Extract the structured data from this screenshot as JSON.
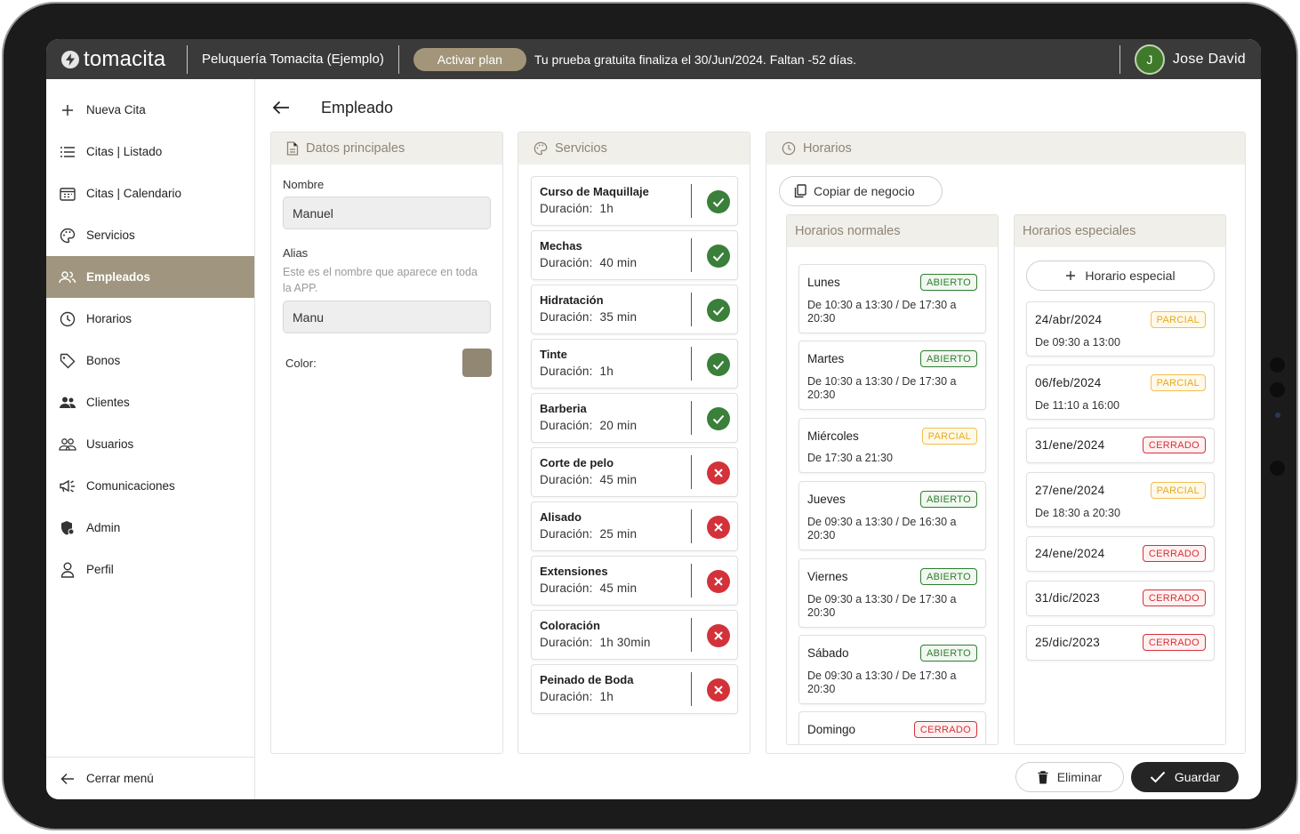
{
  "topbar": {
    "logo_text": "tomacita",
    "business_name": "Peluquería Tomacita (Ejemplo)",
    "activate_label": "Activar plan",
    "trial_text": "Tu prueba gratuita finaliza el 30/Jun/2024. Faltan -52 días.",
    "user_initial": "J",
    "user_name": "Jose David"
  },
  "sidebar": {
    "items": [
      {
        "label": "Nueva Cita",
        "icon": "plus-icon"
      },
      {
        "label": "Citas | Listado",
        "icon": "list-icon"
      },
      {
        "label": "Citas | Calendario",
        "icon": "calendar-icon"
      },
      {
        "label": "Servicios",
        "icon": "palette-icon"
      },
      {
        "label": "Empleados",
        "icon": "people-icon",
        "active": true
      },
      {
        "label": "Horarios",
        "icon": "clock-icon"
      },
      {
        "label": "Bonos",
        "icon": "tag-icon"
      },
      {
        "label": "Clientes",
        "icon": "clients-icon"
      },
      {
        "label": "Usuarios",
        "icon": "users-icon"
      },
      {
        "label": "Comunicaciones",
        "icon": "megaphone-icon"
      },
      {
        "label": "Admin",
        "icon": "admin-shield-icon"
      },
      {
        "label": "Perfil",
        "icon": "person-icon"
      }
    ],
    "close_label": "Cerrar menú"
  },
  "page": {
    "title": "Empleado"
  },
  "datos": {
    "title": "Datos principales",
    "nombre_label": "Nombre",
    "nombre_value": "Manuel",
    "alias_label": "Alias",
    "alias_help": "Este es el nombre que aparece en toda la APP.",
    "alias_value": "Manu",
    "color_label": "Color:",
    "color_value": "#918773"
  },
  "servicios": {
    "title": "Servicios",
    "duration_prefix": "Duración:",
    "items": [
      {
        "name": "Curso de Maquillaje",
        "duration": "1h",
        "enabled": true
      },
      {
        "name": "Mechas",
        "duration": "40 min",
        "enabled": true
      },
      {
        "name": "Hidratación",
        "duration": "35 min",
        "enabled": true
      },
      {
        "name": "Tinte",
        "duration": "1h",
        "enabled": true
      },
      {
        "name": "Barberia",
        "duration": "20 min",
        "enabled": true
      },
      {
        "name": "Corte de pelo",
        "duration": "45 min",
        "enabled": false
      },
      {
        "name": "Alisado",
        "duration": "25 min",
        "enabled": false
      },
      {
        "name": "Extensiones",
        "duration": "45 min",
        "enabled": false
      },
      {
        "name": "Coloración",
        "duration": "1h 30min",
        "enabled": false
      },
      {
        "name": "Peinado de Boda",
        "duration": "1h",
        "enabled": false
      }
    ]
  },
  "horarios": {
    "title": "Horarios",
    "copy_label": "Copiar de negocio",
    "normales_title": "Horarios normales",
    "especiales_title": "Horarios especiales",
    "add_special_label": "Horario especial",
    "days": [
      {
        "day": "Lunes",
        "status": "ABIERTO",
        "times": "De 10:30 a 13:30 / De 17:30 a 20:30"
      },
      {
        "day": "Martes",
        "status": "ABIERTO",
        "times": "De 10:30 a 13:30 / De 17:30 a 20:30"
      },
      {
        "day": "Miércoles",
        "status": "PARCIAL",
        "times": "De 17:30 a 21:30"
      },
      {
        "day": "Jueves",
        "status": "ABIERTO",
        "times": "De 09:30 a 13:30 / De 16:30 a 20:30"
      },
      {
        "day": "Viernes",
        "status": "ABIERTO",
        "times": "De 09:30 a 13:30 / De 17:30 a 20:30"
      },
      {
        "day": "Sábado",
        "status": "ABIERTO",
        "times": "De 09:30 a 13:30 / De 17:30 a 20:30"
      },
      {
        "day": "Domingo",
        "status": "CERRADO",
        "times": ""
      }
    ],
    "special": [
      {
        "date": "24/abr/2024",
        "status": "PARCIAL",
        "times": "De 09:30 a 13:00"
      },
      {
        "date": "06/feb/2024",
        "status": "PARCIAL",
        "times": "De 11:10 a 16:00"
      },
      {
        "date": "31/ene/2024",
        "status": "CERRADO",
        "times": ""
      },
      {
        "date": "27/ene/2024",
        "status": "PARCIAL",
        "times": "De 18:30 a 20:30"
      },
      {
        "date": "24/ene/2024",
        "status": "CERRADO",
        "times": ""
      },
      {
        "date": "31/dic/2023",
        "status": "CERRADO",
        "times": ""
      },
      {
        "date": "25/dic/2023",
        "status": "CERRADO",
        "times": ""
      }
    ]
  },
  "actions": {
    "delete_label": "Eliminar",
    "save_label": "Guardar"
  },
  "colors": {
    "accent": "#a0957e",
    "topbar": "#3a3a3a",
    "open": "#2f7d32",
    "partial": "#e7a91e",
    "closed": "#d3323a"
  }
}
